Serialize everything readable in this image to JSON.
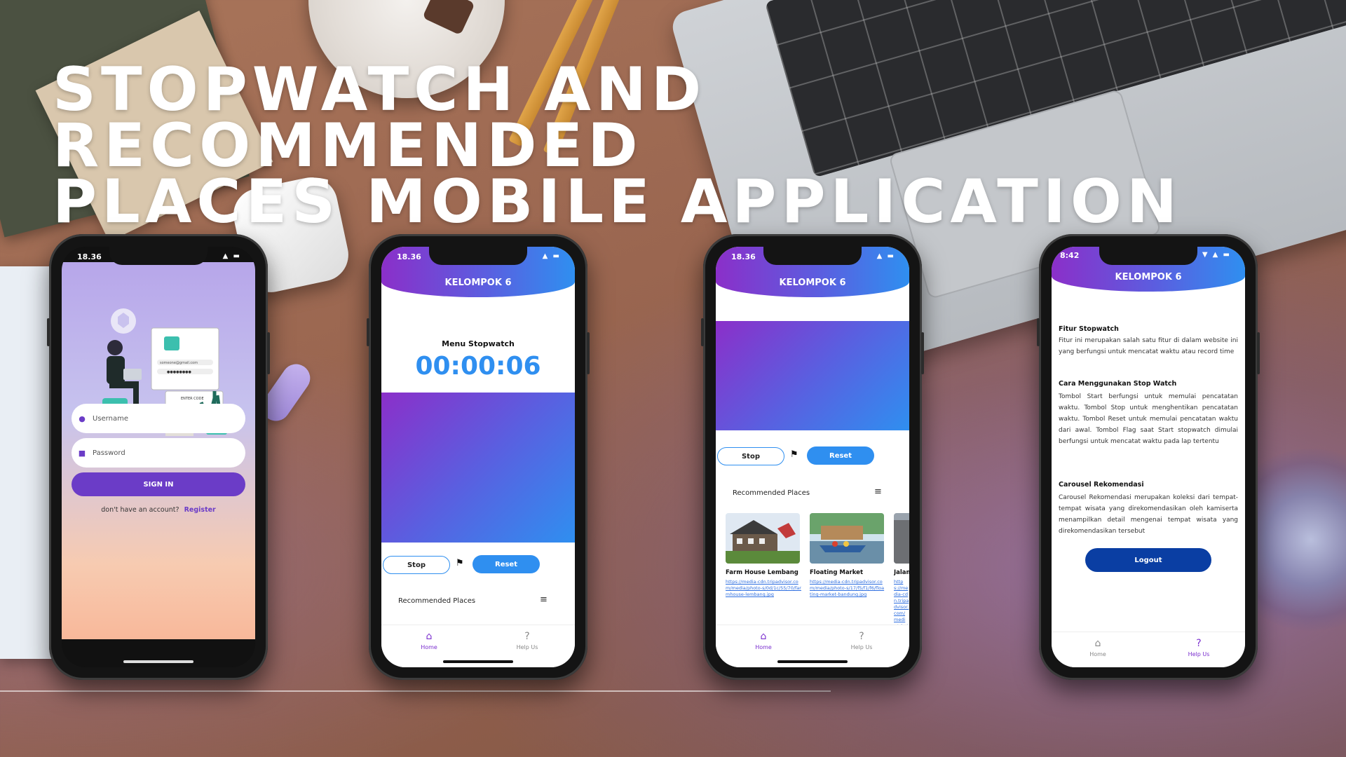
{
  "title_line1": "STOPWATCH AND RECOMMENDED",
  "title_line2": "PLACES MOBILE APPLICATION",
  "colors": {
    "accent_purple": "#6b3cc7",
    "accent_blue": "#2f8ff0",
    "logout_blue": "#0a3ea3"
  },
  "phone1": {
    "status_time": "18.36",
    "username_placeholder": "Username",
    "password_placeholder": "Password",
    "sign_in": "SIGN IN",
    "no_account": "don't have an account?",
    "register": "Register",
    "illustration": {
      "email_text": "someone@gmail.com",
      "password_dots": "●●●●●●●●",
      "enter_code": "ENTER CODE"
    }
  },
  "phone2": {
    "status_time": "18.36",
    "header_title": "KELOMPOK 6",
    "stopwatch_label": "Menu Stopwatch",
    "stopwatch_time": "00:00:06",
    "stop": "Stop",
    "reset": "Reset",
    "recommended": "Recommended Places",
    "nav_home": "Home",
    "nav_help": "Help Us"
  },
  "phone3": {
    "status_time": "18.36",
    "header_title": "KELOMPOK 6",
    "stop": "Stop",
    "reset": "Reset",
    "recommended": "Recommended Places",
    "places": [
      {
        "name": "Farm House Lembang",
        "url": "https://media-cdn.tripadvisor.com/media/photo-s/0d/1c/55/70/farmhouse-lembang.jpg"
      },
      {
        "name": "Floating Market",
        "url": "https://media-cdn.tripadvisor.com/media/photo-s/17/f5/f1/f6/floating-market-bandung.jpg"
      },
      {
        "name": "Jalan",
        "url": "https://media-cdn.tripadvisor.com/media/photo-s/kota"
      }
    ],
    "nav_home": "Home",
    "nav_help": "Help Us"
  },
  "phone4": {
    "status_time": "8:42",
    "header_title": "KELOMPOK 6",
    "sections": [
      {
        "title": "Fitur Stopwatch",
        "text": "Fitur ini merupakan salah satu fitur di dalam website ini yang berfungsi untuk mencatat waktu atau record time"
      },
      {
        "title": "Cara Menggunakan Stop Watch",
        "text": "Tombol Start berfungsi untuk memulai pencatatan waktu. Tombol Stop untuk menghentikan pencatatan waktu. Tombol Reset untuk memulai pencatatan waktu dari awal. Tombol Flag saat Start stopwatch dimulai berfungsi untuk mencatat waktu pada lap tertentu"
      },
      {
        "title": "Carousel Rekomendasi",
        "text": "Carousel Rekomendasi merupakan koleksi dari tempat-tempat wisata yang direkomendasikan oleh kamiserta menampilkan detail mengenai tempat wisata yang direkomendasikan tersebut"
      }
    ],
    "logout": "Logout",
    "nav_home": "Home",
    "nav_help": "Help Us"
  }
}
